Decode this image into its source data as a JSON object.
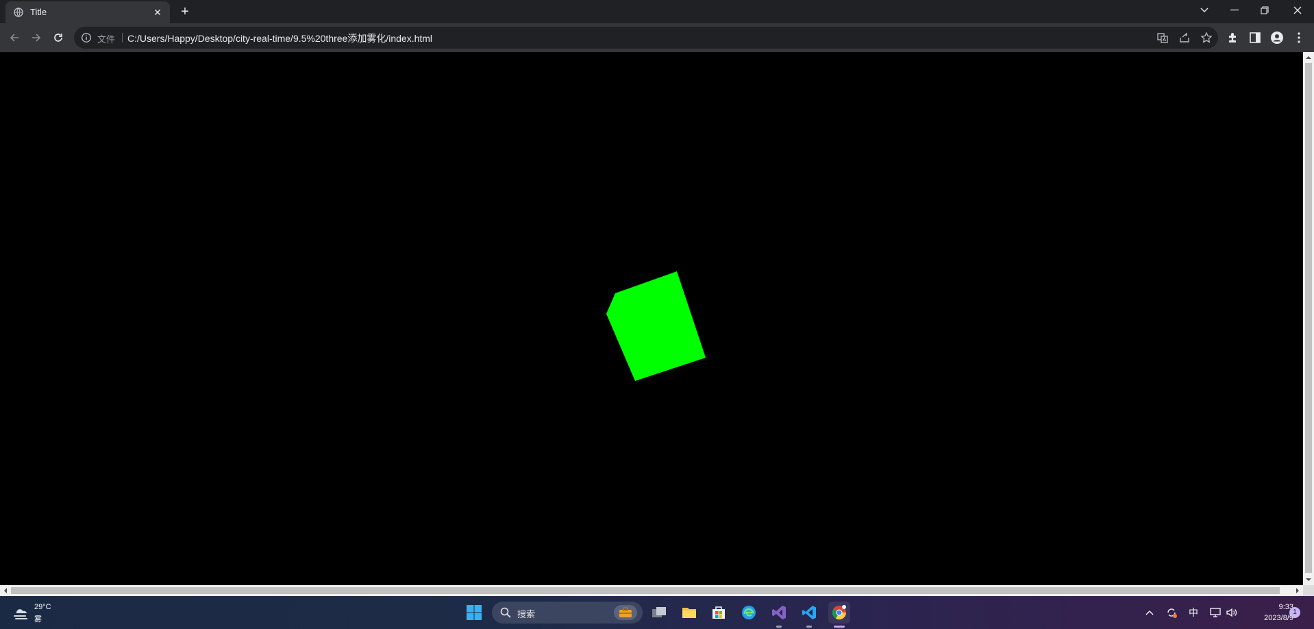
{
  "browser": {
    "tab": {
      "title": "Title"
    },
    "url": {
      "scheme_label": "文件",
      "text": "C:/Users/Happy/Desktop/city-real-time/9.5%20three添加雾化/index.html"
    }
  },
  "scene": {
    "object": "rotating-cube",
    "color": "#00ff00",
    "background": "#000000"
  },
  "taskbar": {
    "weather": {
      "temp": "29°C",
      "desc": "雾"
    },
    "search": {
      "label": "搜索"
    },
    "clock": {
      "time": "9:33",
      "date": "2023/8/9"
    },
    "tray": {
      "ime": "中",
      "notification_count": "1"
    }
  },
  "colors": {
    "chrome_dark": "#202124",
    "toolbar": "#35363a",
    "accent": "#a8c7fa"
  }
}
